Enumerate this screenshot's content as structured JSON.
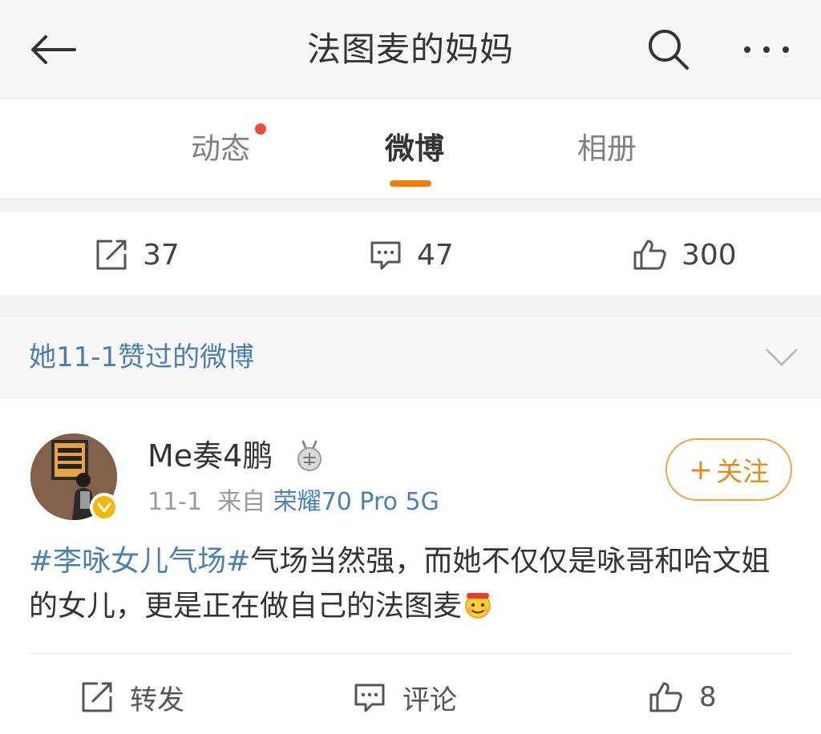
{
  "nav": {
    "title": "法图麦的妈妈",
    "back_icon": "back-arrow-icon",
    "search_icon": "search-icon",
    "more_icon": "more-dots-icon"
  },
  "tabs": [
    {
      "label": "动态",
      "has_dot": true
    },
    {
      "label": "微博",
      "active": true
    },
    {
      "label": "相册"
    }
  ],
  "stats": {
    "reposts": "37",
    "comments": "47",
    "likes": "300"
  },
  "liked_header": {
    "text": "她11-1赞过的微博"
  },
  "post": {
    "author": "Me奏4鹏",
    "date": "11-1",
    "from_label": "来自",
    "source": "荣耀70 Pro 5G",
    "follow_label": "关注",
    "follow_plus": "+",
    "topic": "#李咏女儿气场#",
    "body": "气场当然强，而她不仅仅是咏哥和哈文姐的女儿，更是正在做自己的法图麦",
    "actions": {
      "repost": "转发",
      "comment": "评论",
      "likes": "8"
    }
  },
  "colors": {
    "accent_orange": "#ff7a00",
    "link_blue": "#4a7fb0",
    "red_dot": "#f04c3c",
    "verify_gold": "#f7b500"
  }
}
